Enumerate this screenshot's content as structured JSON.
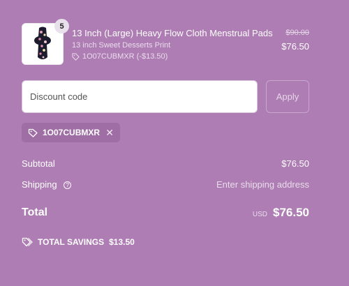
{
  "product": {
    "quantity": "5",
    "name": "13 Inch (Large) Heavy Flow Cloth Menstrual Pads",
    "variant": "13 inch Sweet Desserts Print",
    "discount_tag": "1O07CUBMXR (-$13.50)",
    "compare_price": "$90.00",
    "price": "$76.50",
    "image_icon": "pad-thumbnail"
  },
  "discount": {
    "placeholder": "Discount code",
    "value": "",
    "apply_label": "Apply",
    "applied_code": "1O07CUBMXR"
  },
  "summary": {
    "subtotal_label": "Subtotal",
    "subtotal_value": "$76.50",
    "shipping_label": "Shipping",
    "shipping_value": "Enter shipping address",
    "total_label": "Total",
    "currency": "USD",
    "total_value": "$76.50",
    "savings_label": "TOTAL SAVINGS",
    "savings_value": "$13.50"
  },
  "colors": {
    "background": "#ae7db3",
    "chip": "#9e6ea4"
  }
}
